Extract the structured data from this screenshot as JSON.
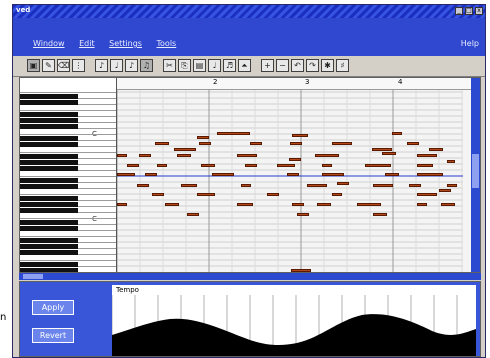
{
  "window": {
    "title": "ved",
    "controls": [
      "_",
      "□",
      "x"
    ]
  },
  "menubar": {
    "items": [
      "Window",
      "Edit",
      "Settings",
      "Tools"
    ],
    "help": "Help"
  },
  "toolbar": {
    "buttons": [
      {
        "icon": "select-icon",
        "glyph": "▣"
      },
      {
        "icon": "draw-icon",
        "glyph": "✎"
      },
      {
        "icon": "erase-icon",
        "glyph": "⌫"
      },
      {
        "icon": "split-icon",
        "glyph": "⋮"
      },
      {
        "icon": "whole-note-icon",
        "glyph": "♪"
      },
      {
        "icon": "half-note-icon",
        "glyph": "♩"
      },
      {
        "icon": "quarter-note-icon",
        "glyph": "♪"
      },
      {
        "icon": "eighth-note-icon",
        "glyph": "♫"
      },
      {
        "icon": "cut-icon",
        "glyph": "✂"
      },
      {
        "icon": "copy-icon",
        "glyph": "⎘"
      },
      {
        "icon": "paste-icon",
        "glyph": "▤"
      },
      {
        "icon": "quantize-icon",
        "glyph": "♩"
      },
      {
        "icon": "transpose-icon",
        "glyph": "♬"
      },
      {
        "icon": "velocity-icon",
        "glyph": "⏶"
      },
      {
        "icon": "zoom-in-icon",
        "glyph": "+"
      },
      {
        "icon": "zoom-out-icon",
        "glyph": "−"
      },
      {
        "icon": "undo-icon",
        "glyph": "↶"
      },
      {
        "icon": "redo-icon",
        "glyph": "↷"
      },
      {
        "icon": "play-icon",
        "glyph": "✱"
      },
      {
        "icon": "record-icon",
        "glyph": "♯"
      }
    ]
  },
  "ruler": {
    "measures": [
      "2",
      "3",
      "4"
    ]
  },
  "keyboard": {
    "octave_labels": [
      "C",
      "C"
    ]
  },
  "controller": {
    "buttons": [
      "Apply",
      "Revert"
    ],
    "lane_label": "Tempo"
  },
  "stray_text": "n",
  "colors": {
    "note": "#b44818",
    "title": "#1a2ec0",
    "accent": "#3048d0"
  }
}
